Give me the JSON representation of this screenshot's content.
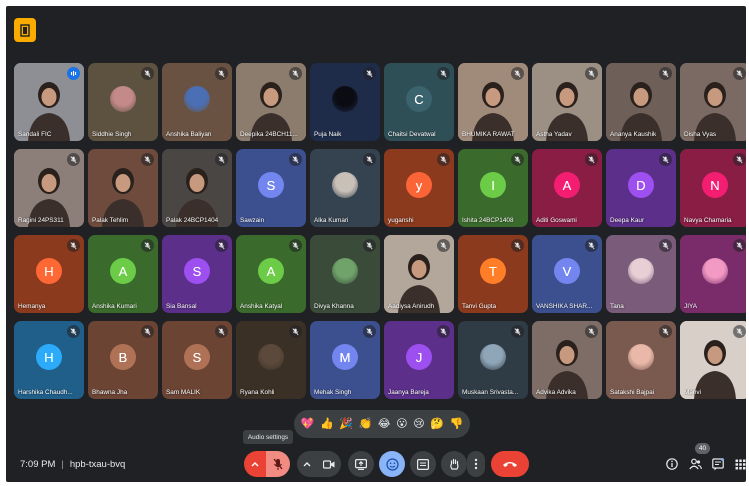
{
  "meeting": {
    "time": "7:09 PM",
    "code": "hpb-txau-bvq"
  },
  "tooltip": "Audio settings",
  "participant_count": "40",
  "reactions": [
    "💖",
    "👍",
    "🎉",
    "👏",
    "😂",
    "😮",
    "😢",
    "🤔",
    "👎"
  ],
  "participants": [
    {
      "name": "Sandali FIC",
      "type": "photo",
      "bg": "#8d8f94",
      "speaking": true
    },
    {
      "name": "Siddhie Singh",
      "type": "pic",
      "bg": "#5d5140",
      "pic": "#c48a8a"
    },
    {
      "name": "Anshika Baliyan",
      "type": "pic",
      "bg": "#6a5242",
      "pic": "#4a6fb5"
    },
    {
      "name": "Deepika 24BCH11...",
      "type": "photo",
      "bg": "#8b7c6e"
    },
    {
      "name": "Puja Naik",
      "type": "pic",
      "bg": "#1e2c4a",
      "pic": "#0b0b12"
    },
    {
      "name": "Chaitsi Devatwal",
      "type": "letter",
      "bg": "#2f4f57",
      "letter": "C",
      "circle": "#2f4f57"
    },
    {
      "name": "BHUMIKA RAWAT",
      "type": "photo",
      "bg": "#a08b7a"
    },
    {
      "name": "Astha Yadav",
      "type": "photo",
      "bg": "#9c8f84"
    },
    {
      "name": "Ananya Kaushik",
      "type": "photo",
      "bg": "#6e6058"
    },
    {
      "name": "Disha Vyas",
      "type": "photo",
      "bg": "#7b6a63"
    },
    {
      "name": "Ragini 24PS311",
      "type": "photo",
      "bg": "#8c7f79"
    },
    {
      "name": "Palak Tehlim",
      "type": "photo",
      "bg": "#6e4b3d"
    },
    {
      "name": "Palak 24BCP1404",
      "type": "photo",
      "bg": "#4a4644"
    },
    {
      "name": "Sawzain",
      "type": "letter",
      "bg": "#3c4f8f",
      "letter": "S",
      "circle": "#5c6bc0"
    },
    {
      "name": "Alka Kumari",
      "type": "pic",
      "bg": "#35424f",
      "pic": "#c9c0b8"
    },
    {
      "name": "yuganshi",
      "type": "letter",
      "bg": "#8b3a1e",
      "letter": "y",
      "circle": "#c9502c"
    },
    {
      "name": "Ishita 24BCP1408",
      "type": "letter",
      "bg": "#3b6b2c",
      "letter": "I",
      "circle": "#56a33a"
    },
    {
      "name": "Aditi Goswami",
      "type": "letter",
      "bg": "#8a1d44",
      "letter": "A",
      "circle": "#c2185b"
    },
    {
      "name": "Deepa Kaur",
      "type": "letter",
      "bg": "#5b2f8a",
      "letter": "D",
      "circle": "#7e3fbf"
    },
    {
      "name": "Navya Chamaria",
      "type": "letter",
      "bg": "#8a1d44",
      "letter": "N",
      "circle": "#c2185b"
    },
    {
      "name": "Hemanya",
      "type": "letter",
      "bg": "#8b3a1e",
      "letter": "H",
      "circle": "#d9532a"
    },
    {
      "name": "Anshika Kumari",
      "type": "letter",
      "bg": "#3b6b2c",
      "letter": "A",
      "circle": "#56a33a"
    },
    {
      "name": "Sia Bansal",
      "type": "letter",
      "bg": "#5b2f8a",
      "letter": "S",
      "circle": "#7e3fbf"
    },
    {
      "name": "Anshika Katyal",
      "type": "letter",
      "bg": "#3b6b2c",
      "letter": "A",
      "circle": "#56a33a"
    },
    {
      "name": "Divya Khanna",
      "type": "pic",
      "bg": "#3a4b3a",
      "pic": "#6fa36a"
    },
    {
      "name": "Aadiysa Anirudh",
      "type": "photo",
      "bg": "#b3a69b"
    },
    {
      "name": "Tanvi Gupta",
      "type": "letter",
      "bg": "#8b3a1e",
      "letter": "T",
      "circle": "#e0651f"
    },
    {
      "name": "VANSHIKA SHAR...",
      "type": "letter",
      "bg": "#3c4f8f",
      "letter": "V",
      "circle": "#5c6bc0"
    },
    {
      "name": "Tana",
      "type": "pic",
      "bg": "#7a5c7a",
      "pic": "#e8cfd6"
    },
    {
      "name": "JIYA",
      "type": "pic",
      "bg": "#7a2c6a",
      "pic": "#f29ac4"
    },
    {
      "name": "Harshika Chaudh...",
      "type": "letter",
      "bg": "#1f5f8a",
      "letter": "H",
      "circle": "#2389c9"
    },
    {
      "name": "Bhawna Jha",
      "type": "letter",
      "bg": "#6b4434",
      "letter": "B",
      "circle": "#8d5b45"
    },
    {
      "name": "Sam MALIK",
      "type": "letter",
      "bg": "#6b4434",
      "letter": "S",
      "circle": "#8d5b45"
    },
    {
      "name": "Ryana Kohli",
      "type": "pic",
      "bg": "#3b3026",
      "pic": "#5b4a3b"
    },
    {
      "name": "Mehak Singh",
      "type": "letter",
      "bg": "#3c4f8f",
      "letter": "M",
      "circle": "#5c6bc0"
    },
    {
      "name": "Jaanya Bareja",
      "type": "letter",
      "bg": "#5b2f8a",
      "letter": "J",
      "circle": "#7e3fbf"
    },
    {
      "name": "Muskaan Srivasta...",
      "type": "pic",
      "bg": "#2f3b45",
      "pic": "#8fa6b8"
    },
    {
      "name": "Advika Advika",
      "type": "photo",
      "bg": "#7d6d66"
    },
    {
      "name": "Satakshi Bajpai",
      "type": "pic",
      "bg": "#7a5a4f",
      "pic": "#e9b8a8"
    },
    {
      "name": "Manvi",
      "type": "photo",
      "bg": "#d8d0c8"
    }
  ]
}
